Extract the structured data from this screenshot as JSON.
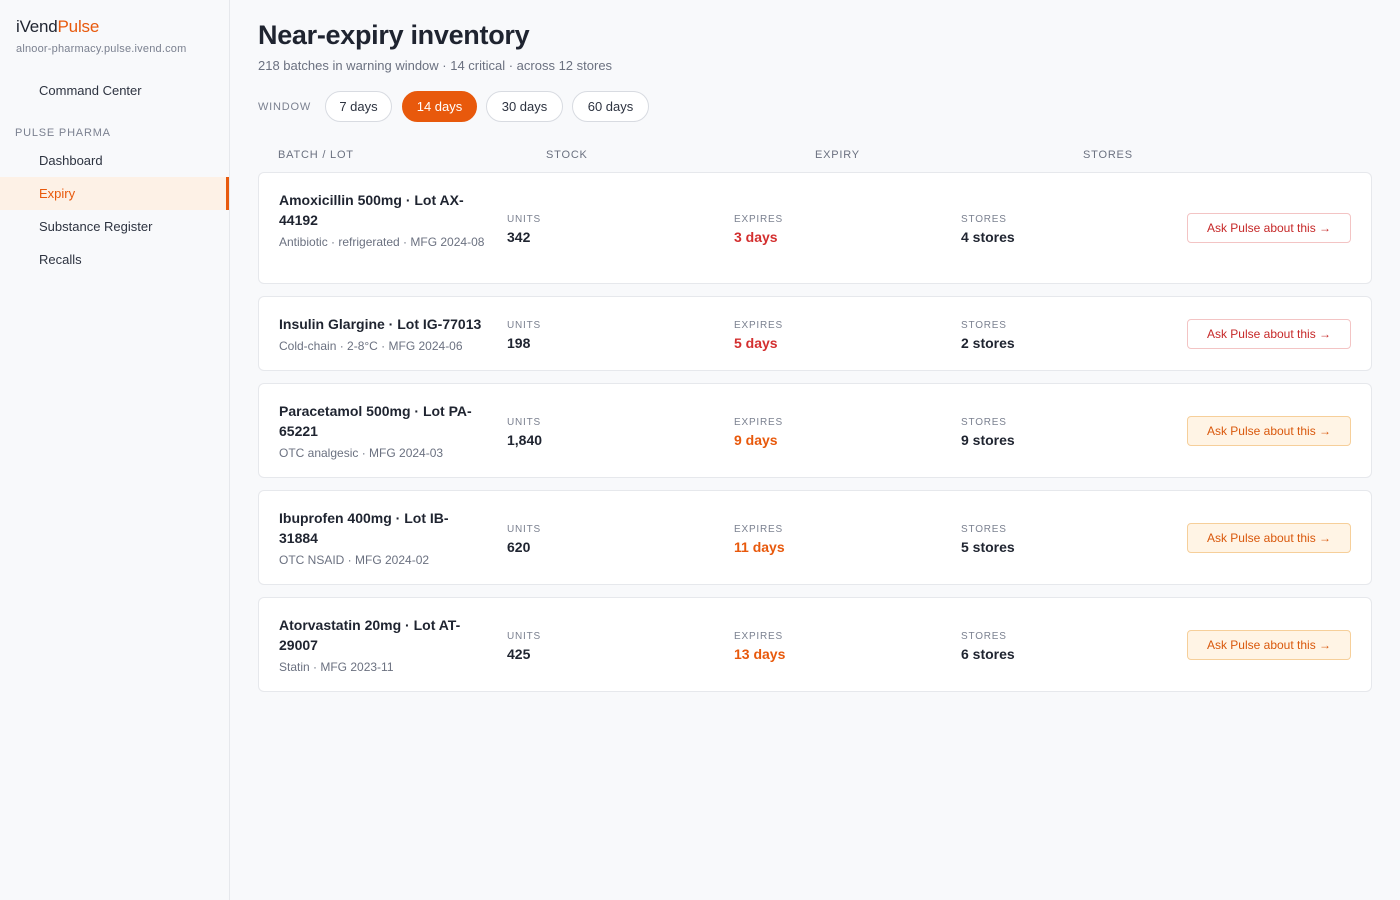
{
  "brand": {
    "part1": "iVend",
    "part2": "Pulse",
    "domain": "alnoor-pharmacy.pulse.ivend.com"
  },
  "nav": {
    "top_item": "Command Center",
    "section_label": "PULSE PHARMA",
    "items": [
      {
        "label": "Dashboard",
        "active": false
      },
      {
        "label": "Expiry",
        "active": true
      },
      {
        "label": "Substance Register",
        "active": false
      },
      {
        "label": "Recalls",
        "active": false
      }
    ]
  },
  "page": {
    "title": "Near-expiry inventory",
    "subtitle": "218 batches in warning window · 14 critical · across 12 stores"
  },
  "window": {
    "label": "WINDOW",
    "options": [
      "7 days",
      "14 days",
      "30 days",
      "60 days"
    ],
    "selected": "14 days"
  },
  "columns": [
    "BATCH / LOT",
    "STOCK",
    "EXPIRY",
    "STORES"
  ],
  "row_labels": {
    "units": "UNITS",
    "expires": "EXPIRES",
    "stores": "STORES",
    "action": "Ask Pulse about this →"
  },
  "rows": [
    {
      "name": "Amoxicillin 500mg · Lot AX-44192",
      "meta": "Antibiotic · refrigerated · MFG 2024-08",
      "units": "342",
      "expires": "3 days",
      "stores": "4 stores",
      "severity": "critical"
    },
    {
      "name": "Insulin Glargine · Lot IG-77013",
      "meta": "Cold-chain · 2-8°C · MFG 2024-06",
      "units": "198",
      "expires": "5 days",
      "stores": "2 stores",
      "severity": "critical"
    },
    {
      "name": "Paracetamol 500mg · Lot PA-65221",
      "meta": "OTC analgesic · MFG 2024-03",
      "units": "1,840",
      "expires": "9 days",
      "stores": "9 stores",
      "severity": "warning"
    },
    {
      "name": "Ibuprofen 400mg · Lot IB-31884",
      "meta": "OTC NSAID · MFG 2024-02",
      "units": "620",
      "expires": "11 days",
      "stores": "5 stores",
      "severity": "warning"
    },
    {
      "name": "Atorvastatin 20mg · Lot AT-29007",
      "meta": "Statin · MFG 2023-11",
      "units": "425",
      "expires": "13 days",
      "stores": "6 stores",
      "severity": "warning"
    }
  ],
  "colors": {
    "accent": "#e8590c",
    "critical": "#d32f2f",
    "warning": "#e8590c"
  }
}
